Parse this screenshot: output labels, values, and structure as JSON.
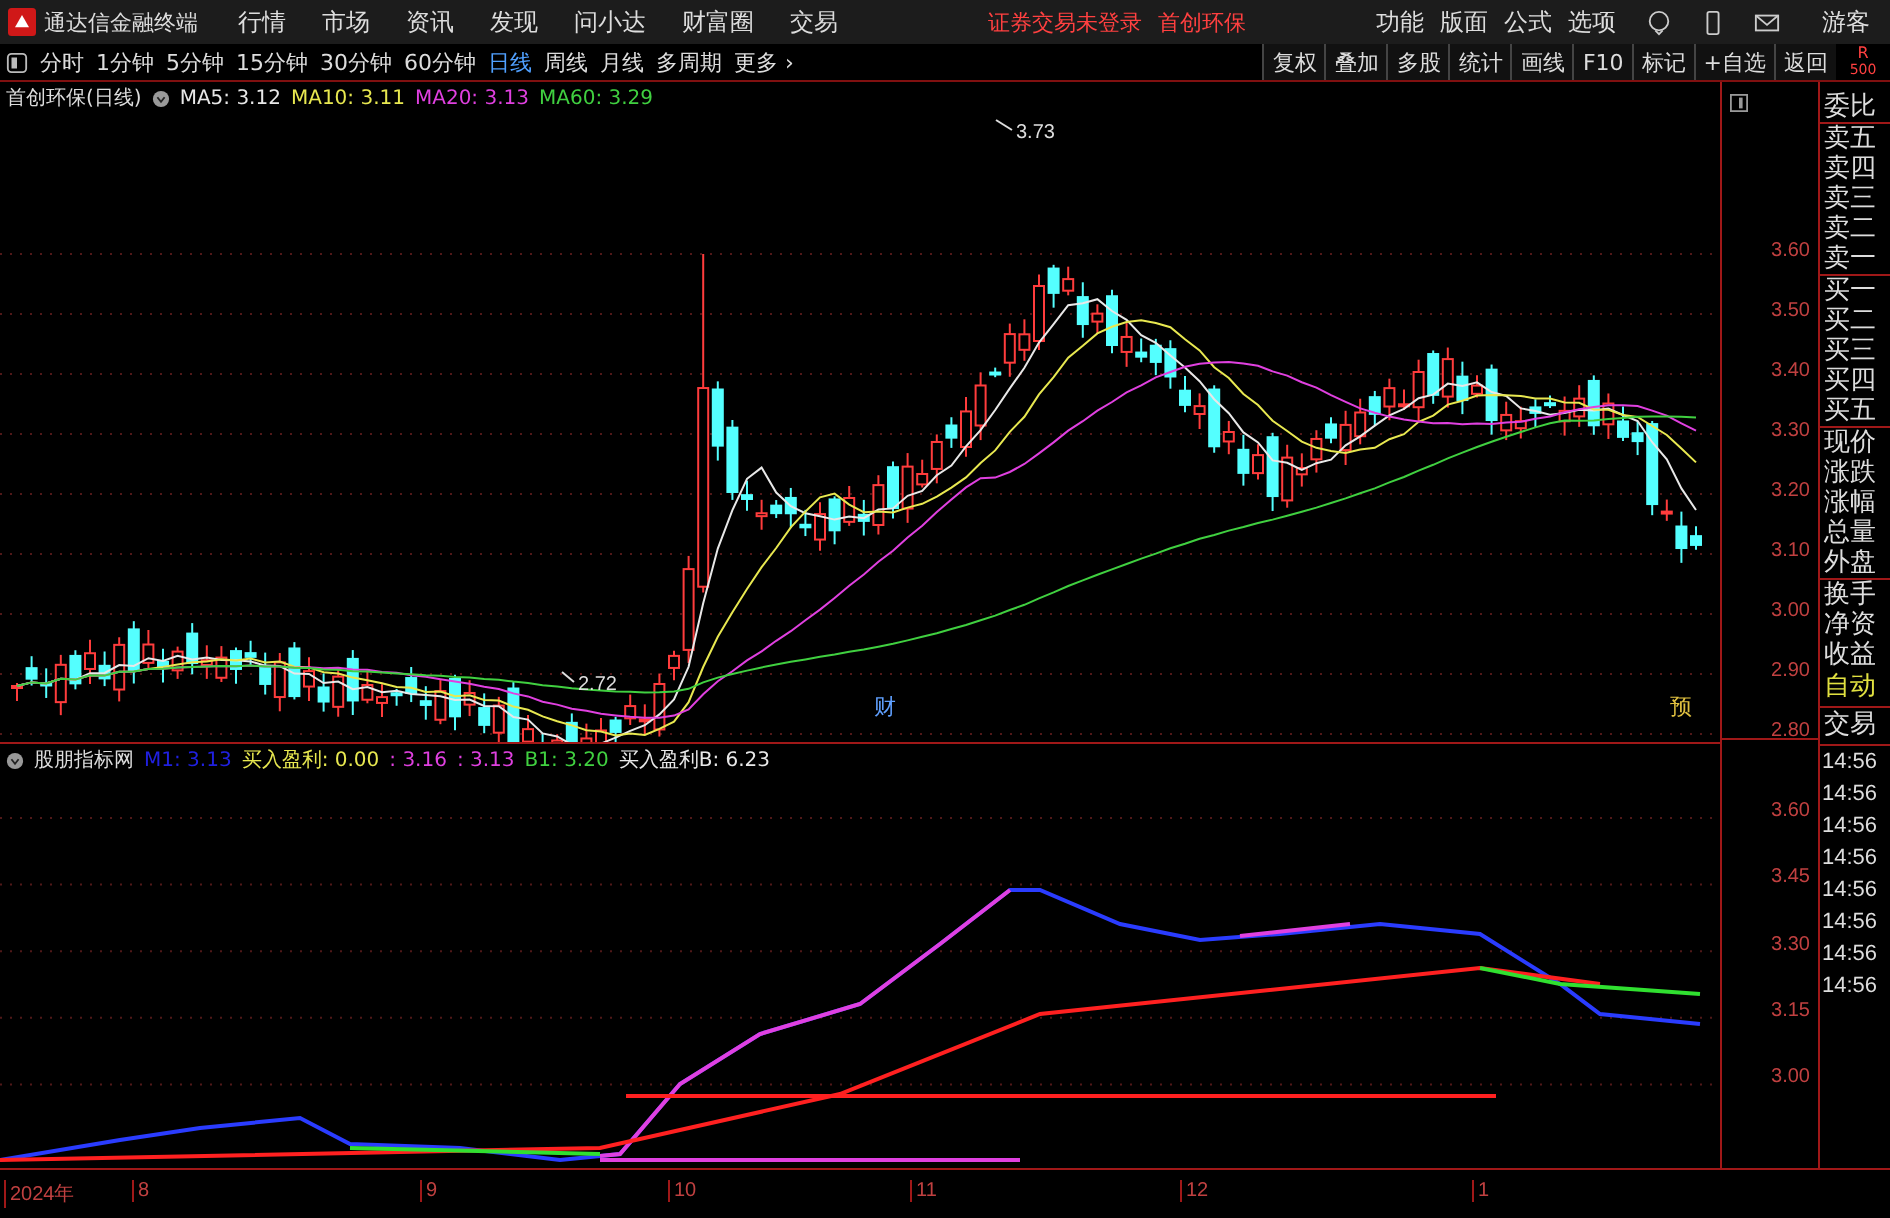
{
  "app": {
    "title": "通达信金融终端"
  },
  "menu": [
    {
      "label": "行情"
    },
    {
      "label": "市场"
    },
    {
      "label": "资讯"
    },
    {
      "label": "发现"
    },
    {
      "label": "问小达"
    },
    {
      "label": "财富圈"
    },
    {
      "label": "交易"
    }
  ],
  "notice": [
    "证券交易未登录",
    "首创环保"
  ],
  "right_menu": [
    {
      "label": "功能"
    },
    {
      "label": "版面"
    },
    {
      "label": "公式"
    },
    {
      "label": "选项"
    }
  ],
  "user": "游客",
  "periods": [
    {
      "label": "分时",
      "selected": false
    },
    {
      "label": "1分钟",
      "selected": false
    },
    {
      "label": "5分钟",
      "selected": false
    },
    {
      "label": "15分钟",
      "selected": false
    },
    {
      "label": "30分钟",
      "selected": false
    },
    {
      "label": "60分钟",
      "selected": false
    },
    {
      "label": "日线",
      "selected": true
    },
    {
      "label": "周线",
      "selected": false
    },
    {
      "label": "月线",
      "selected": false
    },
    {
      "label": "多周期",
      "selected": false
    },
    {
      "label": "更多 ›",
      "selected": false
    }
  ],
  "tools": [
    "复权",
    "叠加",
    "多股",
    "统计",
    "画线",
    "F10",
    "标记",
    "+自选",
    "返回"
  ],
  "corner": [
    "R",
    "500"
  ],
  "main_chart": {
    "title": "首创环保(日线)",
    "legend": [
      {
        "text": "MA5: 3.12",
        "color": "#e8e8e8"
      },
      {
        "text": "MA10: 3.11",
        "color": "#e8e850"
      },
      {
        "text": "MA20: 3.13",
        "color": "#e040e0"
      },
      {
        "text": "MA60: 3.29",
        "color": "#40d040"
      }
    ],
    "high_label": "3.73",
    "low_label": "2.72",
    "markers": [
      "财",
      "预"
    ],
    "y_axis": [
      "3.60",
      "3.50",
      "3.40",
      "3.30",
      "3.20",
      "3.10",
      "3.00",
      "2.90",
      "2.80"
    ]
  },
  "indicator": {
    "title": "股朋指标网",
    "legend": [
      {
        "text": "M1: 3.13",
        "color": "#2020e0"
      },
      {
        "text": "买入盈利: 0.00",
        "color": "#e8e850"
      },
      {
        "text": ": 3.16",
        "color": "#e040e0"
      },
      {
        "text": ": 3.13",
        "color": "#e040e0"
      },
      {
        "text": "B1: 3.20",
        "color": "#40d040"
      },
      {
        "text": "买入盈利B: 6.23",
        "color": "#e8e8e8"
      }
    ],
    "y_axis": [
      "3.60",
      "3.45",
      "3.30",
      "3.15",
      "3.00"
    ]
  },
  "time_axis": [
    "2024年",
    "8",
    "9",
    "10",
    "11",
    "12",
    "1"
  ],
  "side_panel": [
    "委比",
    "卖五",
    "卖四",
    "卖三",
    "卖二",
    "卖一",
    "买一",
    "买二",
    "买三",
    "买四",
    "买五",
    "现价",
    "涨跌",
    "涨幅",
    "总量",
    "外盘",
    "换手",
    "净资",
    "收益"
  ],
  "side_tabs": [
    "自动",
    "交易"
  ],
  "trades": [
    "14:56",
    "14:56",
    "14:56",
    "14:56",
    "14:56",
    "14:56",
    "14:56",
    "14:56"
  ]
}
